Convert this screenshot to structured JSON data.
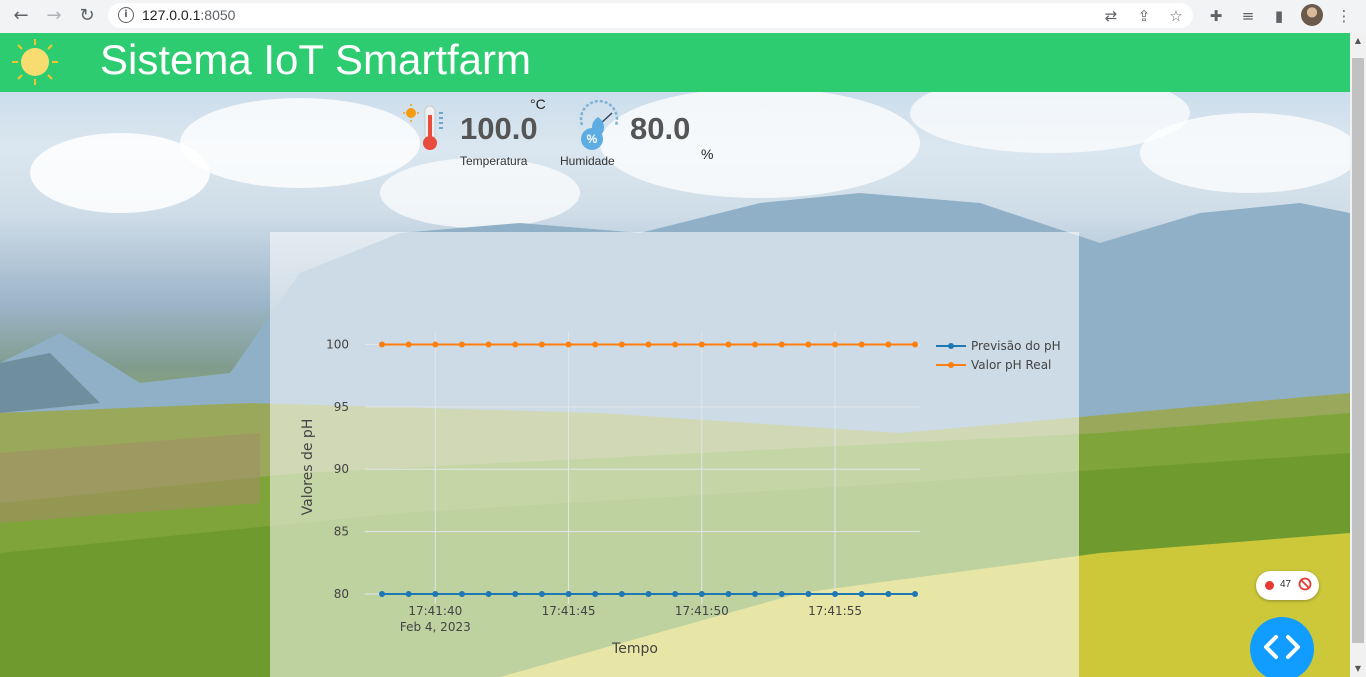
{
  "browser": {
    "url_host": "127.0.0.1",
    "url_port": ":8050"
  },
  "header": {
    "title": "Sistema IoT Smartfarm"
  },
  "metrics": {
    "temperature": {
      "value": "100.0",
      "unit": "°C",
      "label": "Temperatura"
    },
    "humidity": {
      "value": "80.0",
      "unit": "%",
      "label": "Humidade",
      "icon_text": "%"
    }
  },
  "chart_data": {
    "type": "line",
    "xlabel": "Tempo",
    "ylabel": "Valores de pH",
    "x_tick_labels": [
      "17:41:40",
      "17:41:45",
      "17:41:50",
      "17:41:55"
    ],
    "x_date_label": "Feb 4, 2023",
    "x": [
      "17:41:38",
      "17:41:39",
      "17:41:40",
      "17:41:41",
      "17:41:42",
      "17:41:43",
      "17:41:44",
      "17:41:45",
      "17:41:46",
      "17:41:47",
      "17:41:48",
      "17:41:49",
      "17:41:50",
      "17:41:51",
      "17:41:52",
      "17:41:53",
      "17:41:54",
      "17:41:55",
      "17:41:56",
      "17:41:57",
      "17:41:58"
    ],
    "y_ticks": [
      80,
      85,
      90,
      95,
      100
    ],
    "ylim": [
      79.2,
      101
    ],
    "grid": true,
    "legend_position": "top-right",
    "series": [
      {
        "name": "Previsão do pH",
        "color": "#1f77b4",
        "values": [
          80,
          80,
          80,
          80,
          80,
          80,
          80,
          80,
          80,
          80,
          80,
          80,
          80,
          80,
          80,
          80,
          80,
          80,
          80,
          80,
          80
        ]
      },
      {
        "name": "Valor pH Real",
        "color": "#ff7f0e",
        "values": [
          100,
          100,
          100,
          100,
          100,
          100,
          100,
          100,
          100,
          100,
          100,
          100,
          100,
          100,
          100,
          100,
          100,
          100,
          100,
          100,
          100
        ]
      }
    ]
  },
  "dash_debug": {
    "error_count": "47",
    "button_color": "#119dff"
  },
  "colors": {
    "header": "#2ecc71",
    "title_text": "#ffffff"
  }
}
